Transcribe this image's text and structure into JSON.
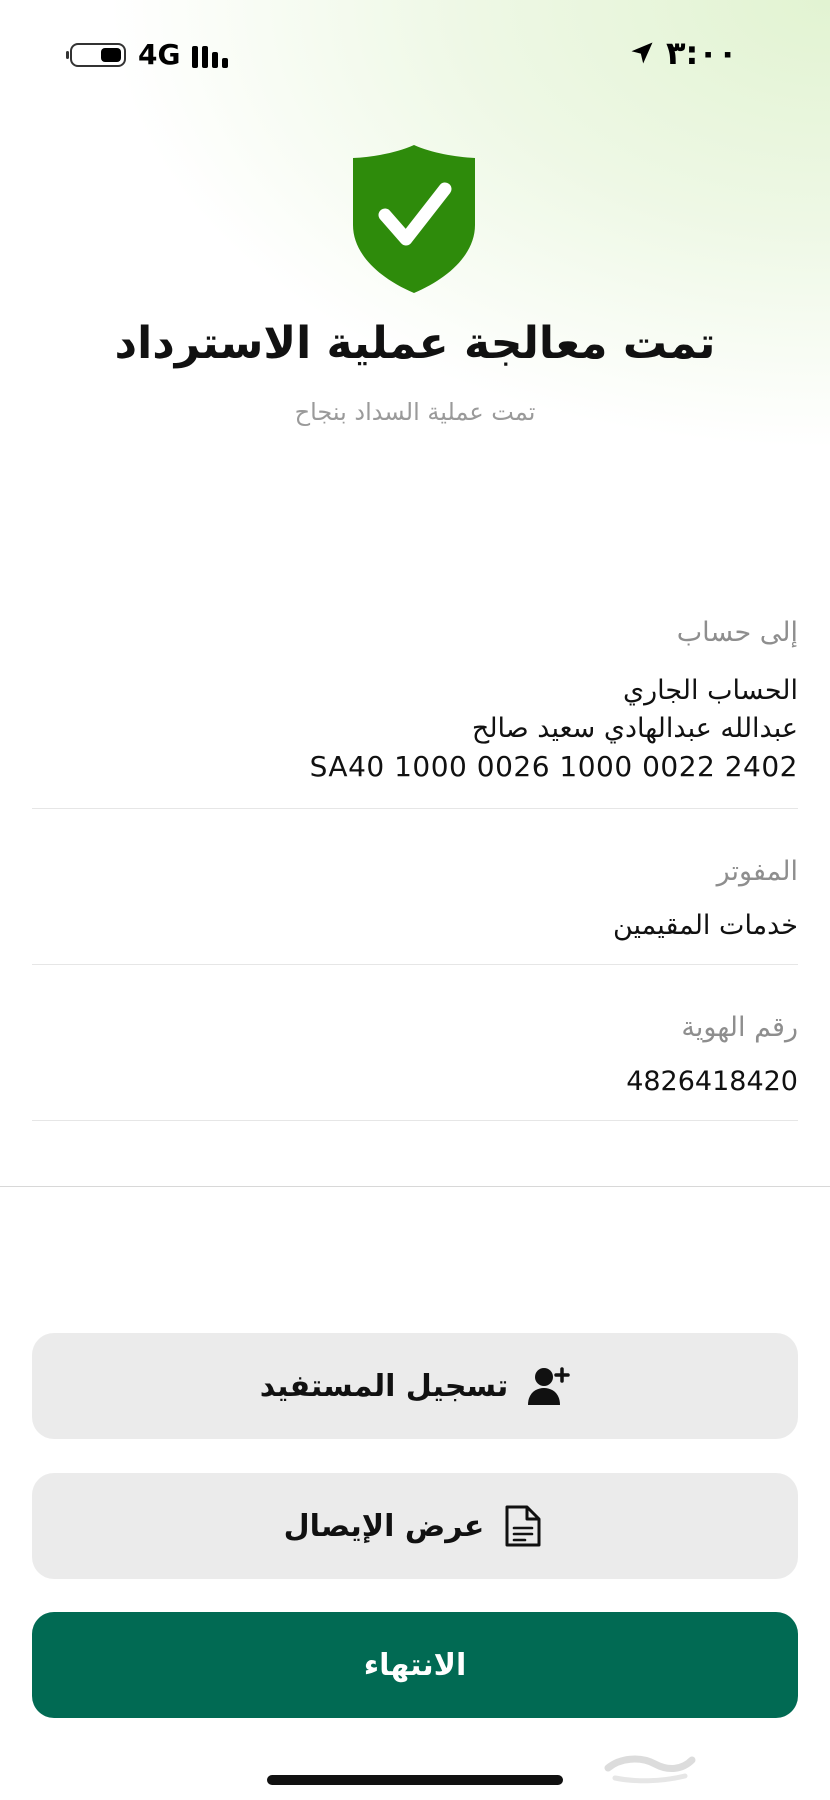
{
  "status_bar": {
    "time": "٣:٠٠",
    "network": "4G",
    "icons": [
      "location-arrow-icon",
      "signal-bars-icon",
      "battery-icon"
    ]
  },
  "header": {
    "icon": "shield-check-icon",
    "icon_color": "#2e8b0b",
    "title": "تمت معالجة عملية الاسترداد",
    "subtitle": "تمت عملية السداد بنجاح"
  },
  "details": {
    "account": {
      "label": "إلى حساب",
      "account_type": "الحساب الجاري",
      "holder_name": "عبدالله عبدالهادي سعيد صالح",
      "iban": "SA40 1000 0026 1000 0022 2402"
    },
    "biller": {
      "label": "المفوتر",
      "value": "خدمات المقيمين"
    },
    "id_number": {
      "label": "رقم الهوية",
      "value": "4826418420"
    }
  },
  "actions": {
    "register_beneficiary": {
      "label": "تسجيل المستفيد",
      "icon": "add-user-icon"
    },
    "view_receipt": {
      "label": "عرض الإيصال",
      "icon": "document-icon"
    },
    "finish": {
      "label": "الانتهاء"
    }
  },
  "colors": {
    "primary": "#016a53",
    "success": "#2e8b0b",
    "secondary_button": "#ebebeb",
    "muted_text": "#8e8e8e"
  }
}
